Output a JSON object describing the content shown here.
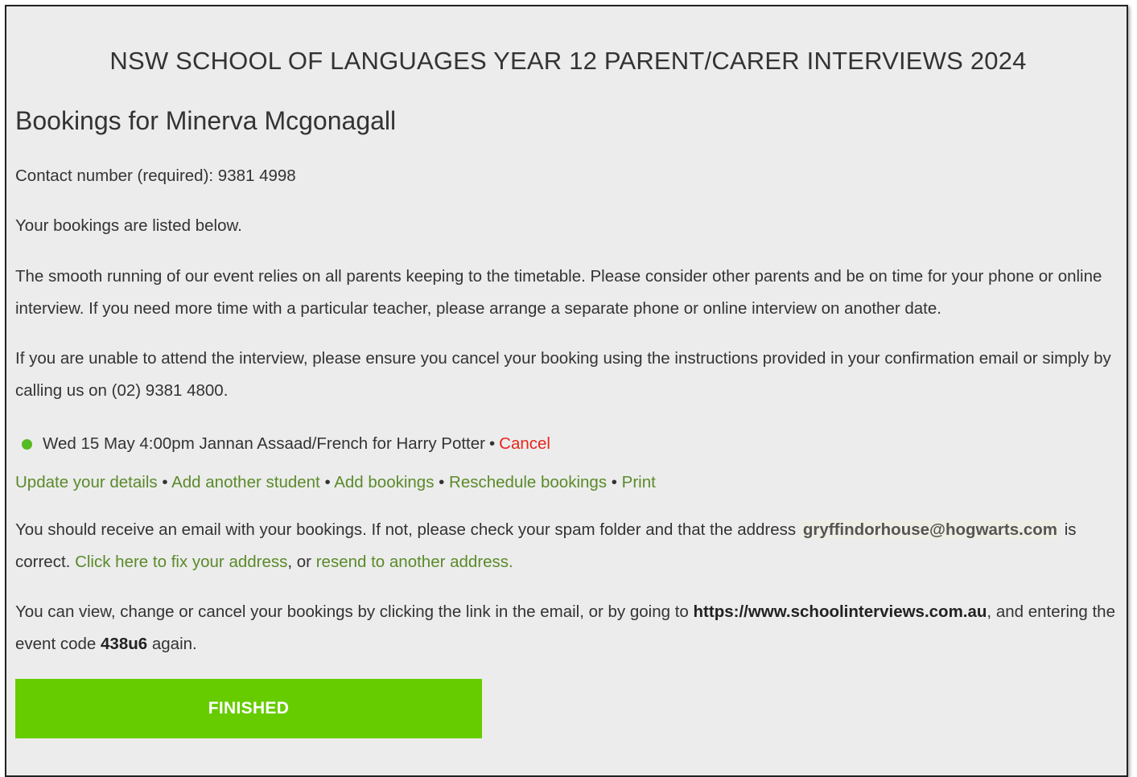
{
  "event_title": "NSW SCHOOL OF LANGUAGES YEAR 12 PARENT/CARER INTERVIEWS 2024",
  "heading": "Bookings for Minerva Mcgonagall",
  "contact": "Contact number (required): 9381 4998",
  "bookings_intro": "Your bookings are listed below.",
  "timetable_notice": "The smooth running of our event relies on all parents keeping to the timetable. Please consider other parents and be on time for your phone or online interview. If you need more time with a particular teacher, please arrange a separate phone or online interview on another date.",
  "cancel_notice": "If you are unable to attend the interview, please ensure you cancel your booking using the instructions provided in your confirmation email or simply by calling us on (02) 9381 4800.",
  "booking": {
    "text": "Wed 15 May 4:00pm Jannan Assaad/French for Harry Potter",
    "separator": "•",
    "cancel_label": "Cancel",
    "status_color": "#55bb22"
  },
  "actions": [
    {
      "label": "Update your details"
    },
    {
      "label": "Add another student"
    },
    {
      "label": "Add bookings"
    },
    {
      "label": "Reschedule bookings"
    },
    {
      "label": "Print"
    }
  ],
  "separator": "•",
  "email_notice": {
    "part1": "You should receive an email with your bookings. If not, please check your spam folder and that the address",
    "email": "gryffindorhouse@hogwarts.com",
    "part2": "is correct.",
    "fix_link": "Click here to fix your address",
    "part3": ", or",
    "resend_link": "resend to another address."
  },
  "view_notice": {
    "part1": "You can view, change or cancel your bookings by clicking the link in the email, or by going to",
    "url": "https://www.schoolinterviews.com.au",
    "part2": ", and entering the event code",
    "code": "438u6",
    "part3": "again."
  },
  "finish_label": "FINISHED",
  "colors": {
    "link_green": "#5a8a2a",
    "cancel_red": "#e8261d",
    "button_green": "#66cc00",
    "background": "#ececec"
  }
}
